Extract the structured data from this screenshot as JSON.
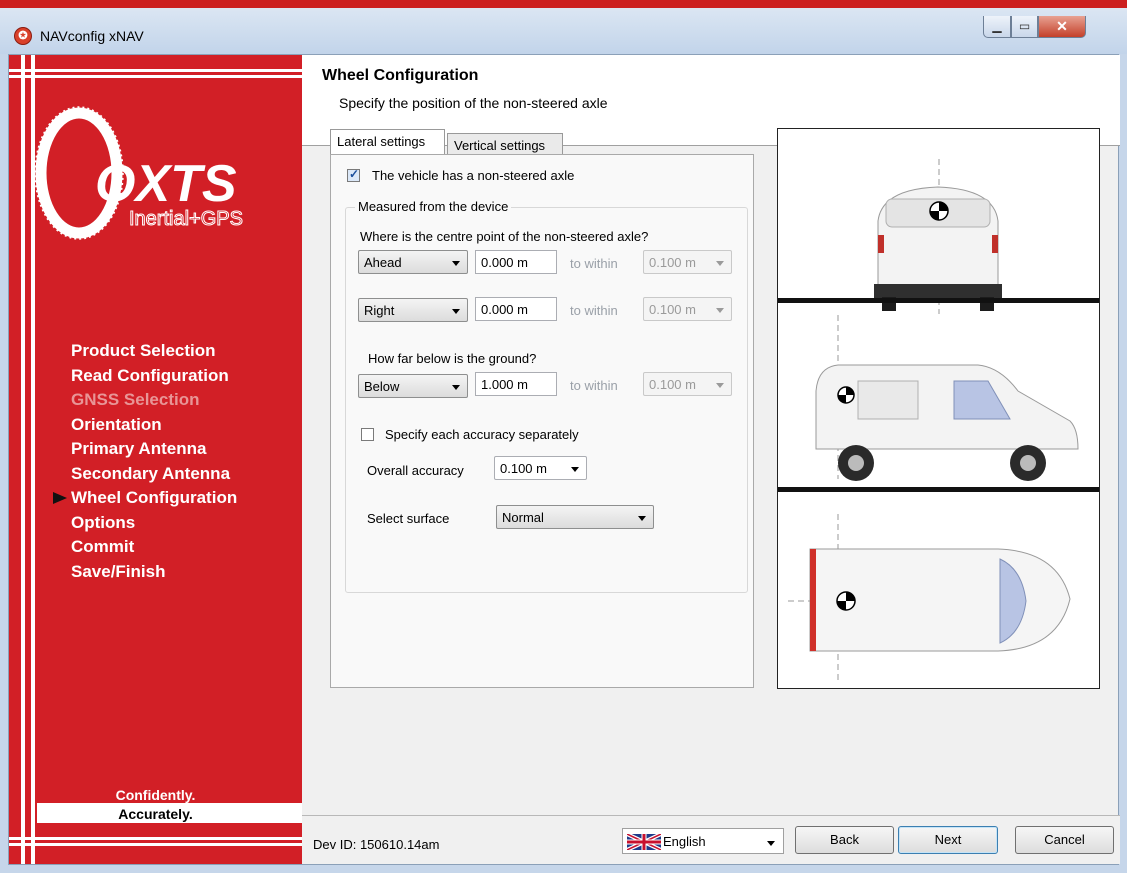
{
  "window": {
    "title": "NAVconfig xNAV",
    "icon": "app-logo-icon"
  },
  "sidebar": {
    "logo_text": "OXTS",
    "logo_sub": "Inertial+GPS",
    "items": [
      {
        "label": "Product Selection",
        "state": "normal"
      },
      {
        "label": "Read Configuration",
        "state": "normal"
      },
      {
        "label": "GNSS Selection",
        "state": "disabled"
      },
      {
        "label": "Orientation",
        "state": "normal"
      },
      {
        "label": "Primary Antenna",
        "state": "normal"
      },
      {
        "label": "Secondary Antenna",
        "state": "normal"
      },
      {
        "label": "Wheel Configuration",
        "state": "current"
      },
      {
        "label": "Options",
        "state": "normal"
      },
      {
        "label": "Commit",
        "state": "normal"
      },
      {
        "label": "Save/Finish",
        "state": "normal"
      }
    ],
    "slogan1": "Confidently.",
    "slogan2": "Accurately."
  },
  "header": {
    "title": "Wheel Configuration",
    "subtitle": "Specify the position of the non-steered axle"
  },
  "tabs": [
    {
      "label": "Lateral settings",
      "active": true
    },
    {
      "label": "Vertical settings",
      "active": false
    }
  ],
  "form": {
    "has_axle_label": "The vehicle has a non-steered axle",
    "has_axle_checked": true,
    "group_label": "Measured from the device",
    "question1": "Where is the centre point of the non-steered axle?",
    "row1": {
      "direction": "Ahead",
      "value": "0.000 m",
      "within_label": "to within",
      "accuracy": "0.100 m"
    },
    "row2": {
      "direction": "Right",
      "value": "0.000 m",
      "within_label": "to within",
      "accuracy": "0.100 m"
    },
    "question2": "How far below is the ground?",
    "row3": {
      "direction": "Below",
      "value": "1.000 m",
      "within_label": "to within",
      "accuracy": "0.100 m"
    },
    "separate_label": "Specify each accuracy separately",
    "separate_checked": false,
    "overall_label": "Overall accuracy",
    "overall_value": "0.100 m",
    "surface_label": "Select surface",
    "surface_value": "Normal"
  },
  "footer": {
    "dev_id": "Dev ID: 150610.14am",
    "language": "English",
    "back": "Back",
    "next": "Next",
    "cancel": "Cancel"
  },
  "colors": {
    "brand_red": "#d21f26",
    "titlebar": "#c6d6ea"
  }
}
